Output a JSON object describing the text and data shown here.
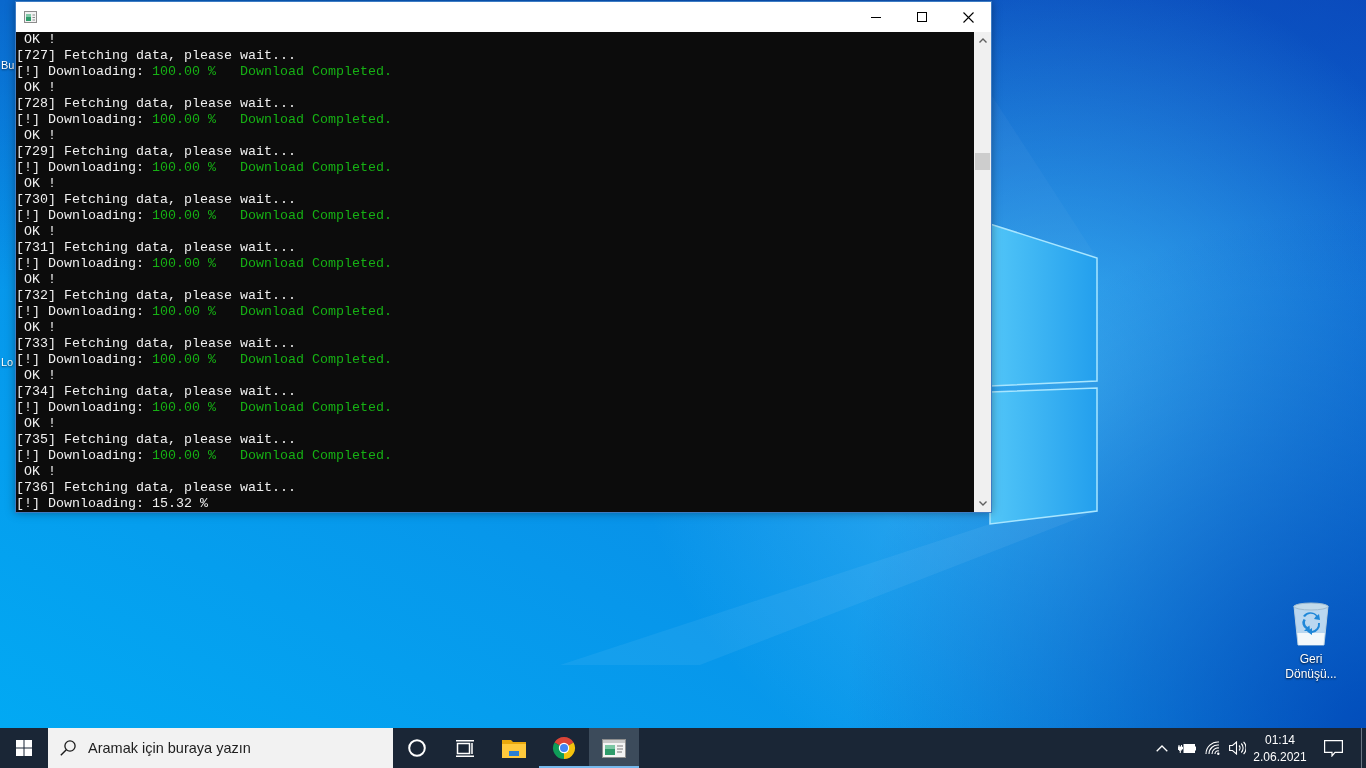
{
  "desktop": {
    "partial_icon_labels": [
      "Bu",
      "Lo"
    ],
    "recycle_bin": {
      "label": "Geri Dönüşü..."
    }
  },
  "console_window": {
    "title_bar": {
      "buttons": [
        {
          "kind": "minimize"
        },
        {
          "kind": "maximize"
        },
        {
          "kind": "close"
        }
      ]
    },
    "lines": [
      {
        "kind": "ok",
        "text": "OK !"
      },
      {
        "kind": "fetch",
        "text": "[727] Fetching data, please wait..."
      },
      {
        "kind": "progress",
        "label": "[!] Downloading:",
        "value": "100.00 %",
        "completed": true,
        "message": "Download Completed."
      },
      {
        "kind": "ok",
        "text": "OK !"
      },
      {
        "kind": "fetch",
        "text": "[728] Fetching data, please wait..."
      },
      {
        "kind": "progress",
        "label": "[!] Downloading:",
        "value": "100.00 %",
        "completed": true,
        "message": "Download Completed."
      },
      {
        "kind": "ok",
        "text": "OK !"
      },
      {
        "kind": "fetch",
        "text": "[729] Fetching data, please wait..."
      },
      {
        "kind": "progress",
        "label": "[!] Downloading:",
        "value": "100.00 %",
        "completed": true,
        "message": "Download Completed."
      },
      {
        "kind": "ok",
        "text": "OK !"
      },
      {
        "kind": "fetch",
        "text": "[730] Fetching data, please wait..."
      },
      {
        "kind": "progress",
        "label": "[!] Downloading:",
        "value": "100.00 %",
        "completed": true,
        "message": "Download Completed."
      },
      {
        "kind": "ok",
        "text": "OK !"
      },
      {
        "kind": "fetch",
        "text": "[731] Fetching data, please wait..."
      },
      {
        "kind": "progress",
        "label": "[!] Downloading:",
        "value": "100.00 %",
        "completed": true,
        "message": "Download Completed."
      },
      {
        "kind": "ok",
        "text": "OK !"
      },
      {
        "kind": "fetch",
        "text": "[732] Fetching data, please wait..."
      },
      {
        "kind": "progress",
        "label": "[!] Downloading:",
        "value": "100.00 %",
        "completed": true,
        "message": "Download Completed."
      },
      {
        "kind": "ok",
        "text": "OK !"
      },
      {
        "kind": "fetch",
        "text": "[733] Fetching data, please wait..."
      },
      {
        "kind": "progress",
        "label": "[!] Downloading:",
        "value": "100.00 %",
        "completed": true,
        "message": "Download Completed."
      },
      {
        "kind": "ok",
        "text": "OK !"
      },
      {
        "kind": "fetch",
        "text": "[734] Fetching data, please wait..."
      },
      {
        "kind": "progress",
        "label": "[!] Downloading:",
        "value": "100.00 %",
        "completed": true,
        "message": "Download Completed."
      },
      {
        "kind": "ok",
        "text": "OK !"
      },
      {
        "kind": "fetch",
        "text": "[735] Fetching data, please wait..."
      },
      {
        "kind": "progress",
        "label": "[!] Downloading:",
        "value": "100.00 %",
        "completed": true,
        "message": "Download Completed."
      },
      {
        "kind": "ok",
        "text": "OK !"
      },
      {
        "kind": "fetch",
        "text": "[736] Fetching data, please wait..."
      },
      {
        "kind": "progress",
        "label": "[!] Downloading:",
        "value": "15.32 %",
        "completed": false
      }
    ]
  },
  "taskbar": {
    "search": {
      "placeholder": "Aramak için buraya yazın"
    },
    "buttons": [
      {
        "kind": "cortana"
      },
      {
        "kind": "task_view"
      }
    ],
    "apps": [
      {
        "kind": "folder",
        "running": false,
        "selected": false
      },
      {
        "kind": "browser",
        "running": true,
        "selected": false
      },
      {
        "kind": "console",
        "running": true,
        "selected": true
      }
    ],
    "tray": {
      "icons": [
        {
          "kind": "chevron"
        },
        {
          "kind": "battery"
        },
        {
          "kind": "wifi"
        },
        {
          "kind": "volume"
        }
      ],
      "time": "01:14",
      "date": "2.06.2021"
    }
  }
}
